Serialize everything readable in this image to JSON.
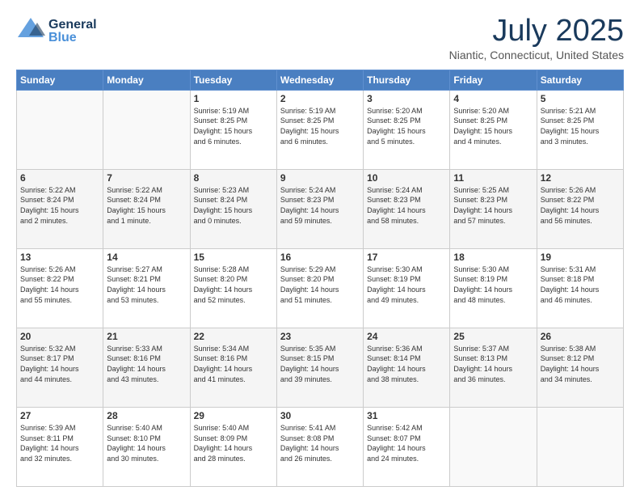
{
  "header": {
    "logo_general": "General",
    "logo_blue": "Blue",
    "main_title": "July 2025",
    "subtitle": "Niantic, Connecticut, United States"
  },
  "days_of_week": [
    "Sunday",
    "Monday",
    "Tuesday",
    "Wednesday",
    "Thursday",
    "Friday",
    "Saturday"
  ],
  "weeks": [
    [
      {
        "day": "",
        "info": ""
      },
      {
        "day": "",
        "info": ""
      },
      {
        "day": "1",
        "info": "Sunrise: 5:19 AM\nSunset: 8:25 PM\nDaylight: 15 hours\nand 6 minutes."
      },
      {
        "day": "2",
        "info": "Sunrise: 5:19 AM\nSunset: 8:25 PM\nDaylight: 15 hours\nand 6 minutes."
      },
      {
        "day": "3",
        "info": "Sunrise: 5:20 AM\nSunset: 8:25 PM\nDaylight: 15 hours\nand 5 minutes."
      },
      {
        "day": "4",
        "info": "Sunrise: 5:20 AM\nSunset: 8:25 PM\nDaylight: 15 hours\nand 4 minutes."
      },
      {
        "day": "5",
        "info": "Sunrise: 5:21 AM\nSunset: 8:25 PM\nDaylight: 15 hours\nand 3 minutes."
      }
    ],
    [
      {
        "day": "6",
        "info": "Sunrise: 5:22 AM\nSunset: 8:24 PM\nDaylight: 15 hours\nand 2 minutes."
      },
      {
        "day": "7",
        "info": "Sunrise: 5:22 AM\nSunset: 8:24 PM\nDaylight: 15 hours\nand 1 minute."
      },
      {
        "day": "8",
        "info": "Sunrise: 5:23 AM\nSunset: 8:24 PM\nDaylight: 15 hours\nand 0 minutes."
      },
      {
        "day": "9",
        "info": "Sunrise: 5:24 AM\nSunset: 8:23 PM\nDaylight: 14 hours\nand 59 minutes."
      },
      {
        "day": "10",
        "info": "Sunrise: 5:24 AM\nSunset: 8:23 PM\nDaylight: 14 hours\nand 58 minutes."
      },
      {
        "day": "11",
        "info": "Sunrise: 5:25 AM\nSunset: 8:23 PM\nDaylight: 14 hours\nand 57 minutes."
      },
      {
        "day": "12",
        "info": "Sunrise: 5:26 AM\nSunset: 8:22 PM\nDaylight: 14 hours\nand 56 minutes."
      }
    ],
    [
      {
        "day": "13",
        "info": "Sunrise: 5:26 AM\nSunset: 8:22 PM\nDaylight: 14 hours\nand 55 minutes."
      },
      {
        "day": "14",
        "info": "Sunrise: 5:27 AM\nSunset: 8:21 PM\nDaylight: 14 hours\nand 53 minutes."
      },
      {
        "day": "15",
        "info": "Sunrise: 5:28 AM\nSunset: 8:20 PM\nDaylight: 14 hours\nand 52 minutes."
      },
      {
        "day": "16",
        "info": "Sunrise: 5:29 AM\nSunset: 8:20 PM\nDaylight: 14 hours\nand 51 minutes."
      },
      {
        "day": "17",
        "info": "Sunrise: 5:30 AM\nSunset: 8:19 PM\nDaylight: 14 hours\nand 49 minutes."
      },
      {
        "day": "18",
        "info": "Sunrise: 5:30 AM\nSunset: 8:19 PM\nDaylight: 14 hours\nand 48 minutes."
      },
      {
        "day": "19",
        "info": "Sunrise: 5:31 AM\nSunset: 8:18 PM\nDaylight: 14 hours\nand 46 minutes."
      }
    ],
    [
      {
        "day": "20",
        "info": "Sunrise: 5:32 AM\nSunset: 8:17 PM\nDaylight: 14 hours\nand 44 minutes."
      },
      {
        "day": "21",
        "info": "Sunrise: 5:33 AM\nSunset: 8:16 PM\nDaylight: 14 hours\nand 43 minutes."
      },
      {
        "day": "22",
        "info": "Sunrise: 5:34 AM\nSunset: 8:16 PM\nDaylight: 14 hours\nand 41 minutes."
      },
      {
        "day": "23",
        "info": "Sunrise: 5:35 AM\nSunset: 8:15 PM\nDaylight: 14 hours\nand 39 minutes."
      },
      {
        "day": "24",
        "info": "Sunrise: 5:36 AM\nSunset: 8:14 PM\nDaylight: 14 hours\nand 38 minutes."
      },
      {
        "day": "25",
        "info": "Sunrise: 5:37 AM\nSunset: 8:13 PM\nDaylight: 14 hours\nand 36 minutes."
      },
      {
        "day": "26",
        "info": "Sunrise: 5:38 AM\nSunset: 8:12 PM\nDaylight: 14 hours\nand 34 minutes."
      }
    ],
    [
      {
        "day": "27",
        "info": "Sunrise: 5:39 AM\nSunset: 8:11 PM\nDaylight: 14 hours\nand 32 minutes."
      },
      {
        "day": "28",
        "info": "Sunrise: 5:40 AM\nSunset: 8:10 PM\nDaylight: 14 hours\nand 30 minutes."
      },
      {
        "day": "29",
        "info": "Sunrise: 5:40 AM\nSunset: 8:09 PM\nDaylight: 14 hours\nand 28 minutes."
      },
      {
        "day": "30",
        "info": "Sunrise: 5:41 AM\nSunset: 8:08 PM\nDaylight: 14 hours\nand 26 minutes."
      },
      {
        "day": "31",
        "info": "Sunrise: 5:42 AM\nSunset: 8:07 PM\nDaylight: 14 hours\nand 24 minutes."
      },
      {
        "day": "",
        "info": ""
      },
      {
        "day": "",
        "info": ""
      }
    ]
  ]
}
